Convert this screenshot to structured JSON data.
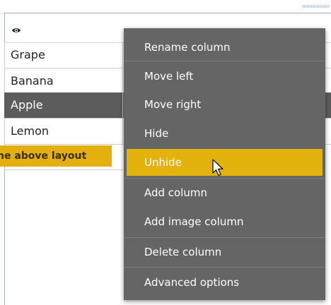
{
  "table": {
    "rows": [
      {
        "label": "Grape",
        "selected": false
      },
      {
        "label": "Banana",
        "selected": false
      },
      {
        "label": "Apple",
        "selected": true
      },
      {
        "label": "Lemon",
        "selected": false
      }
    ],
    "note_text": "he above layout"
  },
  "context_menu": {
    "items": [
      {
        "label": "Rename column"
      },
      {
        "label": "Move left"
      },
      {
        "label": "Move right"
      },
      {
        "label": "Hide"
      },
      {
        "label": "Unhide",
        "highlighted": true
      },
      {
        "label": "Add column"
      },
      {
        "label": "Add image column"
      },
      {
        "label": "Delete column"
      },
      {
        "label": "Advanced options"
      }
    ]
  },
  "colors": {
    "menu_background": "#656565",
    "menu_highlight": "#e4b20d",
    "selected_row": "#5c5c5c",
    "note_bar": "#e3b00f"
  },
  "icons": {
    "header_icon": "eye-icon",
    "cursor": "mouse-pointer-icon"
  }
}
